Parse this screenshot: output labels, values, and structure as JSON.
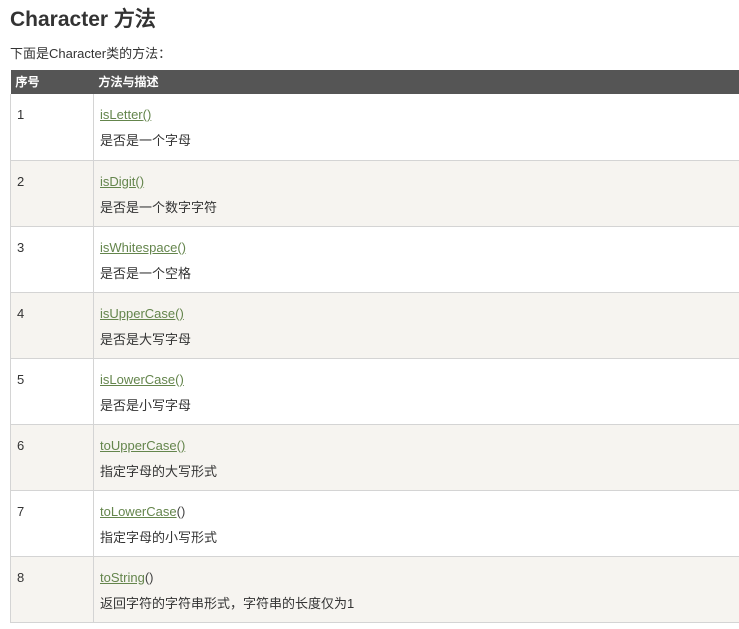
{
  "page": {
    "title": "Character 方法",
    "intro": "下面是Character类的方法："
  },
  "table": {
    "headers": {
      "number": "序号",
      "method": "方法与描述"
    },
    "rows": [
      {
        "number": "1",
        "method_name": "isLetter",
        "method_paren": "()",
        "description": "是否是一个字母"
      },
      {
        "number": "2",
        "method_name": "isDigit",
        "method_paren": "()",
        "description": "是否是一个数字字符"
      },
      {
        "number": "3",
        "method_name": "isWhitespace",
        "method_paren": "()",
        "description": "是否是一个空格"
      },
      {
        "number": "4",
        "method_name": "isUpperCase",
        "method_paren": "()",
        "description": "是否是大写字母"
      },
      {
        "number": "5",
        "method_name": "isLowerCase",
        "method_paren": "()",
        "description": "是否是小写字母"
      },
      {
        "number": "6",
        "method_name": "toUpperCase",
        "method_paren": "()",
        "description": "指定字母的大写形式"
      },
      {
        "number": "7",
        "method_name": "toLowerCase",
        "method_paren": "()",
        "description": "指定字母的小写形式"
      },
      {
        "number": "8",
        "method_name": "toString",
        "method_paren": "()",
        "description": "返回字符的字符串形式，字符串的长度仅为1"
      }
    ]
  },
  "colors": {
    "header_bg": "#555555",
    "link": "#64854c",
    "stripe": "#f6f4f0",
    "text": "#333333"
  }
}
